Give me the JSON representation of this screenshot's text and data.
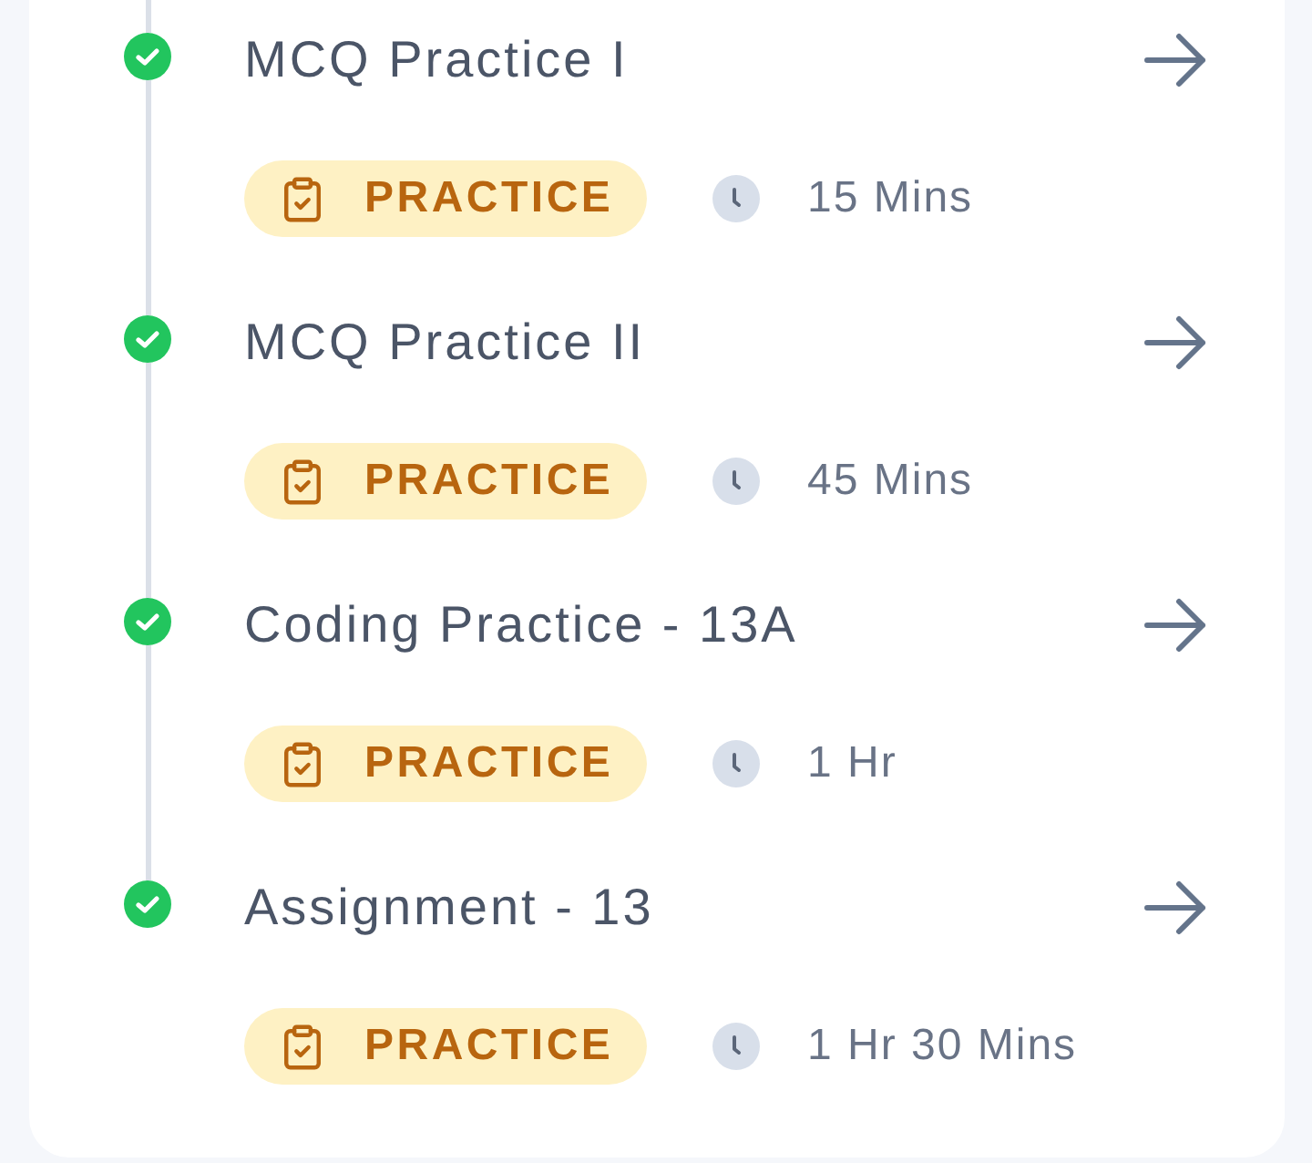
{
  "items": [
    {
      "title": "MCQ Practice I",
      "completed": true,
      "tag": "PRACTICE",
      "duration": "15 Mins"
    },
    {
      "title": "MCQ Practice II",
      "completed": true,
      "tag": "PRACTICE",
      "duration": "45 Mins"
    },
    {
      "title": "Coding Practice - 13A",
      "completed": true,
      "tag": "PRACTICE",
      "duration": "1 Hr"
    },
    {
      "title": "Assignment - 13",
      "completed": true,
      "tag": "PRACTICE",
      "duration": "1 Hr 30 Mins"
    }
  ]
}
